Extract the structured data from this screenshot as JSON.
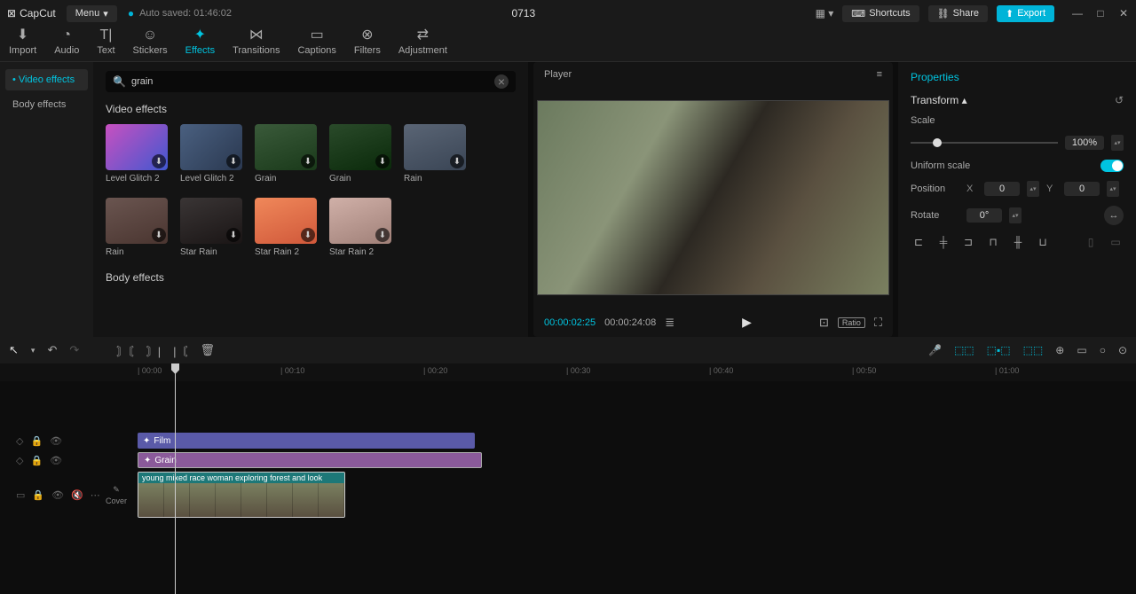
{
  "app": {
    "name": "CapCut",
    "autosave": "Auto saved: 01:46:02",
    "project": "0713"
  },
  "title_buttons": {
    "menu": "Menu",
    "shortcuts": "Shortcuts",
    "share": "Share",
    "export": "Export"
  },
  "main_tabs": [
    {
      "label": "Import",
      "icon": "⬇"
    },
    {
      "label": "Audio",
      "icon": "◔"
    },
    {
      "label": "Text",
      "icon": "T|"
    },
    {
      "label": "Stickers",
      "icon": "☺"
    },
    {
      "label": "Effects",
      "icon": "✦",
      "active": true
    },
    {
      "label": "Transitions",
      "icon": "⋈"
    },
    {
      "label": "Captions",
      "icon": "▭"
    },
    {
      "label": "Filters",
      "icon": "⊗"
    },
    {
      "label": "Adjustment",
      "icon": "⇄"
    }
  ],
  "effects_sidebar": [
    {
      "label": "Video effects",
      "active": true
    },
    {
      "label": "Body effects",
      "active": false
    }
  ],
  "search": {
    "placeholder": "Search",
    "value": "grain"
  },
  "section_video": "Video effects",
  "section_body": "Body effects",
  "effects_row1": [
    {
      "name": "Level Glitch 2"
    },
    {
      "name": "Level Glitch 2"
    },
    {
      "name": "Grain"
    },
    {
      "name": "Grain"
    },
    {
      "name": "Rain"
    }
  ],
  "effects_row2": [
    {
      "name": "Rain"
    },
    {
      "name": "Star Rain"
    },
    {
      "name": "Star Rain 2"
    },
    {
      "name": "Star Rain 2"
    }
  ],
  "player": {
    "title": "Player",
    "current": "00:00:02:25",
    "total": "00:00:24:08",
    "ratio": "Ratio"
  },
  "properties": {
    "title": "Properties",
    "section": "Transform",
    "scale_label": "Scale",
    "scale_value": "100%",
    "uniform_label": "Uniform scale",
    "position_label": "Position",
    "x_label": "X",
    "x_value": "0",
    "y_label": "Y",
    "y_value": "0",
    "rotate_label": "Rotate",
    "rotate_value": "0°"
  },
  "timeline": {
    "ticks": [
      "00:00",
      "00:10",
      "00:20",
      "00:30",
      "00:40",
      "00:50",
      "01:00"
    ],
    "cover": "Cover",
    "clip_film": "Film",
    "clip_grain": "Grain",
    "clip_video": "young mixed race woman exploring forest and look"
  }
}
